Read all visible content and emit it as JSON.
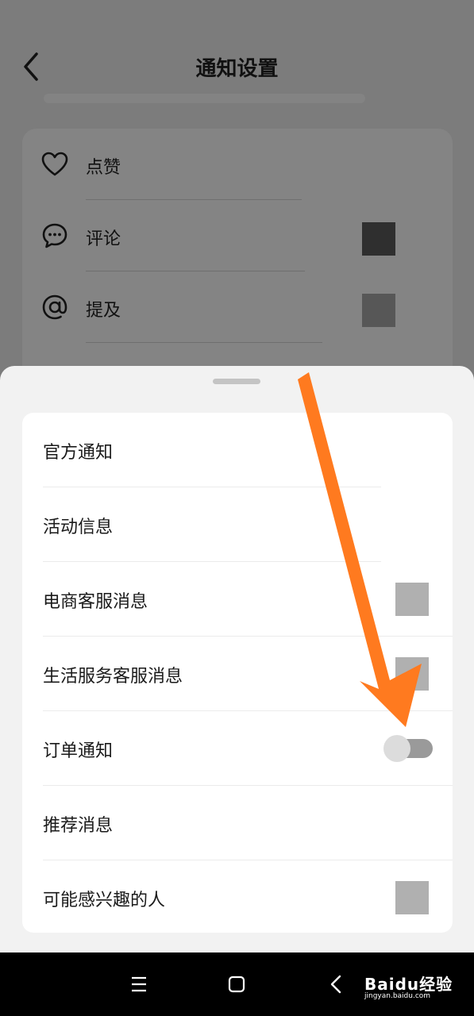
{
  "header": {
    "title": "通知设置"
  },
  "background_list": [
    {
      "label": "点赞",
      "icon": "heart-icon"
    },
    {
      "label": "评论",
      "icon": "comment-icon"
    },
    {
      "label": "提及",
      "icon": "at-icon"
    }
  ],
  "sheet": {
    "items": [
      {
        "label": "官方通知"
      },
      {
        "label": "活动信息"
      },
      {
        "label": "电商客服消息"
      },
      {
        "label": "生活服务客服消息"
      },
      {
        "label": "订单通知",
        "toggle_on": false
      },
      {
        "label": "推荐消息"
      },
      {
        "label": "可能感兴趣的人"
      }
    ]
  },
  "annotation": {
    "arrow_color": "#ff7a1f"
  },
  "watermark": {
    "brand": "Baidu经验",
    "url": "jingyan.baidu.com"
  },
  "colors": {
    "sheet_bg": "#f2f2f2",
    "dim_bg": "#7c7c7c"
  }
}
